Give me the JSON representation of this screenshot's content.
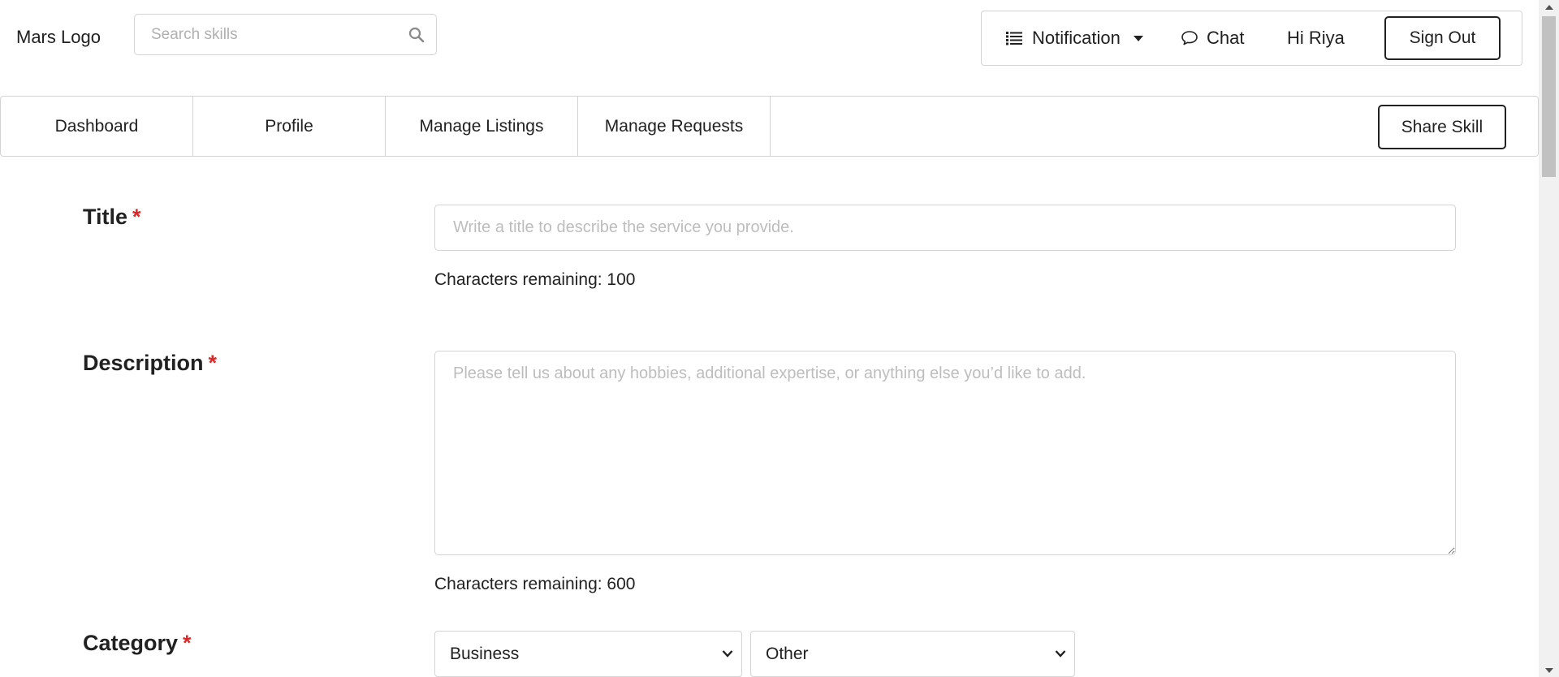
{
  "header": {
    "logo": "Mars Logo",
    "search_placeholder": "Search skills",
    "notification_label": "Notification",
    "chat_label": "Chat",
    "greeting": "Hi Riya",
    "signout_label": "Sign Out"
  },
  "tabs": [
    {
      "label": "Dashboard"
    },
    {
      "label": "Profile"
    },
    {
      "label": "Manage Listings"
    },
    {
      "label": "Manage Requests"
    }
  ],
  "share_skill_label": "Share Skill",
  "form": {
    "required_marker": "*",
    "title": {
      "label": "Title",
      "placeholder": "Write a title to describe the service you provide.",
      "value": "",
      "chars_remaining": "Characters remaining: 100"
    },
    "description": {
      "label": "Description",
      "placeholder": "Please tell us about any hobbies, additional expertise, or anything else you’d like to add.",
      "value": "",
      "chars_remaining": "Characters remaining: 600"
    },
    "category": {
      "label": "Category",
      "selected_category": "Business",
      "selected_subcategory": "Other"
    }
  },
  "icons": {
    "search": "search-icon",
    "notification": "list-icon",
    "dropdown": "caret-down-icon",
    "chat": "chat-bubble-icon",
    "select": "chevron-down-icon"
  }
}
